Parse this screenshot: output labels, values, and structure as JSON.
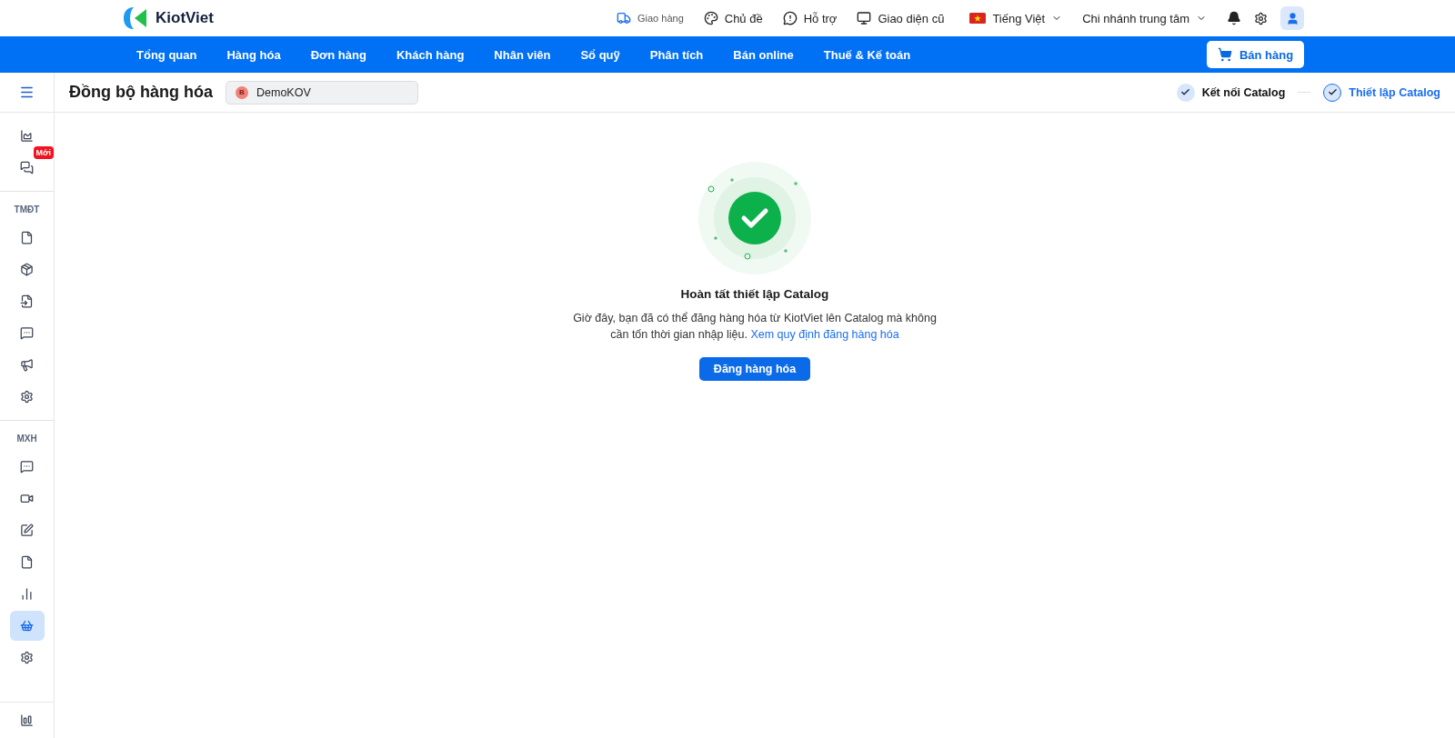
{
  "topbar": {
    "brand": "KiotViet",
    "links": [
      {
        "kind": "delivery",
        "label": "Giao hàng"
      },
      {
        "kind": "theme",
        "label": "Chủ đề"
      },
      {
        "kind": "help",
        "label": "Hỗ trợ"
      },
      {
        "kind": "classic",
        "label": "Giao diện cũ"
      }
    ],
    "language": "Tiếng Việt",
    "branch": "Chi nhánh trung tâm"
  },
  "nav": {
    "items": [
      "Tổng quan",
      "Hàng hóa",
      "Đơn hàng",
      "Khách hàng",
      "Nhân viên",
      "Sổ quỹ",
      "Phân tích",
      "Bán online",
      "Thuế & Kế toán"
    ],
    "sell_button": "Bán hàng"
  },
  "header": {
    "title": "Đồng bộ hàng hóa",
    "shop": {
      "initial": "B",
      "name": "DemoKOV"
    },
    "steps": [
      {
        "label": "Kết nối Catalog",
        "selected": false
      },
      {
        "label": "Thiết lập Catalog",
        "selected": true
      }
    ]
  },
  "sidebar": {
    "groups": [
      {
        "items": [
          {
            "selected": false
          },
          {
            "selected": false,
            "badge": "Mới"
          }
        ]
      },
      {
        "label": "TMĐT",
        "items": [
          {
            "selected": false
          },
          {
            "selected": false
          },
          {
            "selected": false
          },
          {
            "selected": false
          },
          {
            "selected": false
          },
          {
            "selected": false
          }
        ]
      },
      {
        "label": "MXH",
        "items": [
          {
            "selected": false
          },
          {
            "selected": false
          },
          {
            "selected": false
          },
          {
            "selected": false
          },
          {
            "selected": false
          },
          {
            "selected": true
          },
          {
            "selected": false
          }
        ]
      }
    ]
  },
  "result": {
    "title": "Hoàn tất thiết lập Catalog",
    "text": "Giờ đây, bạn đã có thể đăng hàng hóa từ KiotViet lên Catalog mà không cần tốn thời gian nhập liệu.",
    "link": "Xem quy định đăng hàng hóa",
    "button": "Đăng hàng hóa"
  }
}
